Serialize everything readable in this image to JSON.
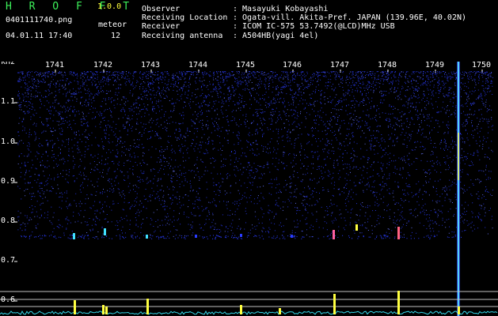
{
  "app": {
    "title": "H R O F F T",
    "version": "1.0.0"
  },
  "capture": {
    "file_name": "0401111740.png",
    "date_time": "04.01.11 17:40",
    "meteor_label": "meteor",
    "meteor_count": "12"
  },
  "info": [
    {
      "key": "Observer",
      "value": ": Masayuki Kobayashi"
    },
    {
      "key": "Receiving Location",
      "value": ": Ogata-vill. Akita-Pref. JAPAN (139.96E, 40.02N)"
    },
    {
      "key": "Receiver",
      "value": ": ICOM IC-575 53.7492(@LCD)MHz USB"
    },
    {
      "key": "Receiving antenna",
      "value": ": A504HB(yagi 4el)"
    }
  ],
  "spectrogram": {
    "unit": "kHz",
    "time_ticks": [
      "1741",
      "1742",
      "1743",
      "1744",
      "1745",
      "1746",
      "1747",
      "1748",
      "1749",
      "1750"
    ],
    "freq_ticks": [
      "1.1",
      "1.0",
      "0.9",
      "0.8",
      "0.7",
      "0.6"
    ],
    "colors": {
      "noise_blue": "#2a3cff",
      "echo_cyan": "#40e0ff",
      "echo_yellow": "#ffff40",
      "baseline_cyan": "#35d6e8"
    }
  }
}
